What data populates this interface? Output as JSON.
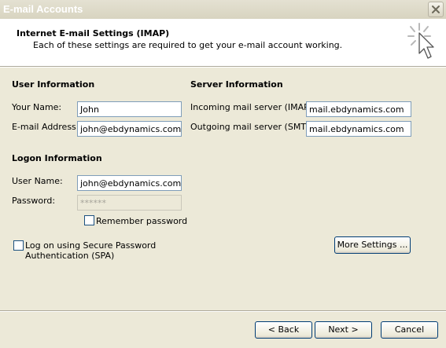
{
  "window": {
    "title": "E-mail Accounts"
  },
  "header": {
    "title": "Internet E-mail Settings (IMAP)",
    "description": "Each of these settings are required to get your e-mail account working."
  },
  "user_info": {
    "heading": "User Information",
    "name_label": "Your Name:",
    "name_value": "John",
    "email_label": "E-mail Address:",
    "email_value": "john@ebdynamics.com"
  },
  "server_info": {
    "heading": "Server Information",
    "incoming_label": "Incoming mail server (IMAP):",
    "incoming_value": "mail.ebdynamics.com",
    "outgoing_label": "Outgoing mail server (SMTP):",
    "outgoing_value": "mail.ebdynamics.com"
  },
  "logon_info": {
    "heading": "Logon Information",
    "username_label": "User Name:",
    "username_value": "john@ebdynamics.com",
    "password_label": "Password:",
    "password_value": "******",
    "remember_label": "Remember password",
    "remember_checked": false
  },
  "spa": {
    "label_line1": "Log on using Secure Password",
    "label_line2": "Authentication (SPA)",
    "checked": false
  },
  "buttons": {
    "more_settings": "More Settings ...",
    "back": "< Back",
    "next": "Next >",
    "cancel": "Cancel"
  },
  "icons": {
    "close": "close-icon",
    "wizard": "wizard-cursor-icon"
  },
  "colors": {
    "dialog_bg": "#ece9d8",
    "field_border": "#7f9db9",
    "button_border": "#003c74"
  }
}
